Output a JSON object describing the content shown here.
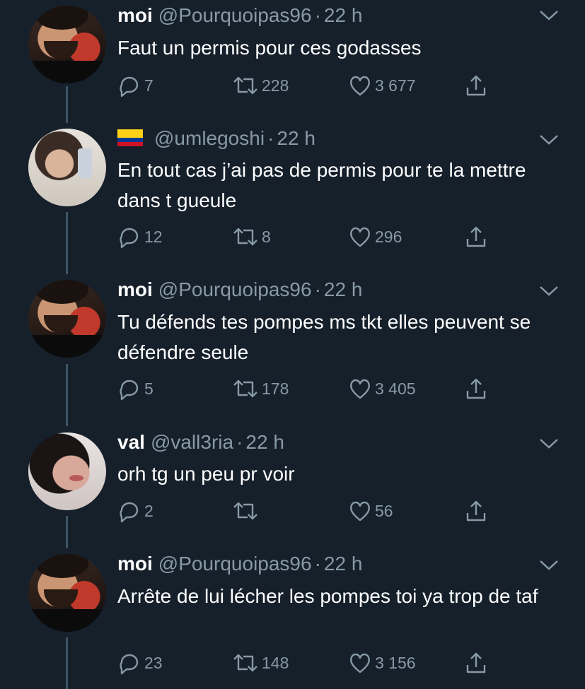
{
  "tweets": [
    {
      "avatar": "moi",
      "name": "moi",
      "flag": false,
      "handle": "@Pourquoipas96",
      "time": "22 h",
      "text": "Faut un permis pour ces godasses",
      "replies": "7",
      "retweets": "228",
      "likes": "3 677"
    },
    {
      "avatar": "uml",
      "name": "",
      "flag": true,
      "handle": "@umlegoshi",
      "time": "22 h",
      "text": "En tout cas j’ai pas de permis pour te la mettre dans t gueule",
      "replies": "12",
      "retweets": "8",
      "likes": "296"
    },
    {
      "avatar": "moi",
      "name": "moi",
      "flag": false,
      "handle": "@Pourquoipas96",
      "time": "22 h",
      "text": "Tu défends tes pompes ms tkt elles peuvent se défendre seule",
      "replies": "5",
      "retweets": "178",
      "likes": "3 405"
    },
    {
      "avatar": "val",
      "name": "val",
      "flag": false,
      "handle": "@vall3ria",
      "time": "22 h",
      "text": "orh tg un peu pr voir",
      "replies": "2",
      "retweets": "",
      "likes": "56"
    },
    {
      "avatar": "moi",
      "name": "moi",
      "flag": false,
      "handle": "@Pourquoipas96",
      "time": "22 h",
      "text": "Arrête de lui lécher les pompes toi ya trop de taf",
      "replies": "23",
      "retweets": "148",
      "likes": "3 156"
    }
  ],
  "separator": "·",
  "icons": {
    "reply": "reply-icon",
    "retweet": "retweet-icon",
    "like": "heart-icon",
    "share": "share-icon",
    "more": "chevron-down-icon",
    "flag": "colombia-flag-icon"
  },
  "colors": {
    "background": "#15202b",
    "text": "#ffffff",
    "muted": "#8899a6",
    "thread_line": "#3d5466"
  }
}
